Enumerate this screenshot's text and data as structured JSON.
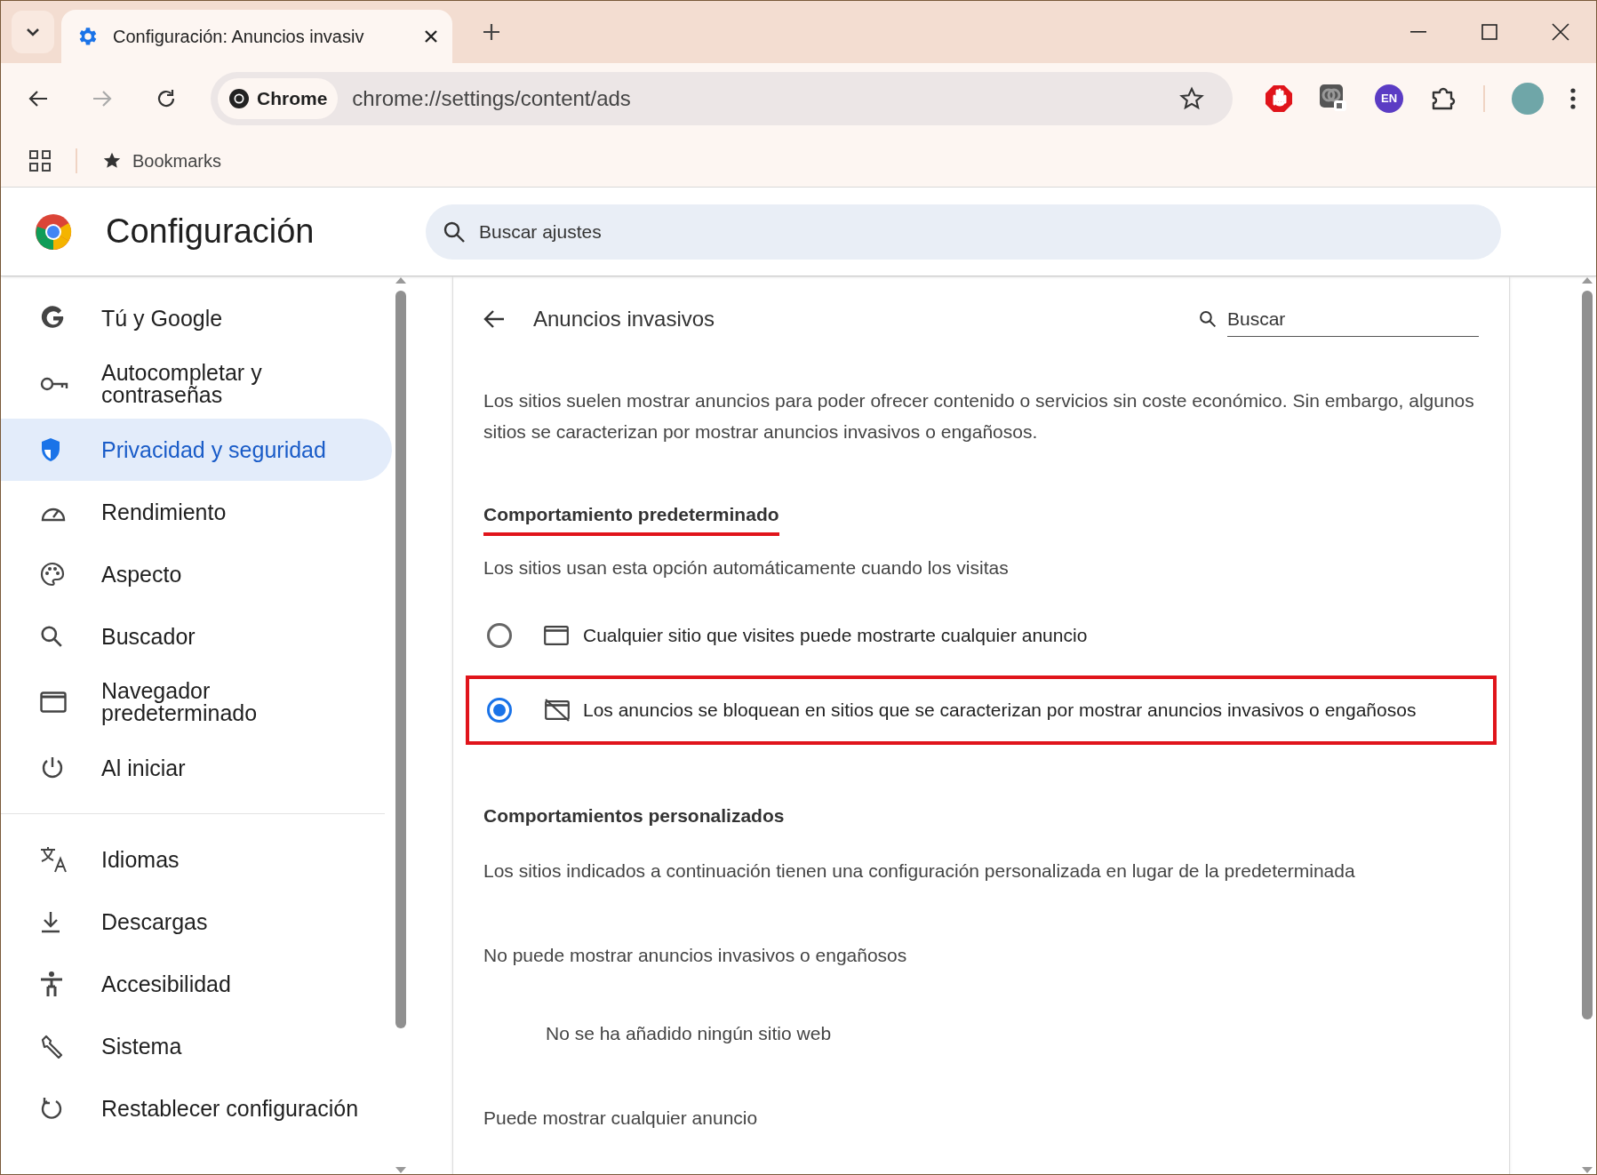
{
  "browser": {
    "tabs": [
      {
        "title": "Configuración: Anuncios invasiv",
        "selected": true
      }
    ],
    "address_bar": {
      "chip": "Chrome",
      "url": "chrome://settings/content/ads"
    },
    "extension_badge": "EN",
    "bookmarks": [
      "Bookmarks"
    ]
  },
  "settings": {
    "title": "Configuración",
    "search": {
      "placeholder": "Buscar ajustes"
    },
    "sidebar": [
      [
        {
          "label": "Tú y Google",
          "selected": false
        },
        {
          "label": "Autocompletar y contraseñas",
          "selected": false
        },
        {
          "label": "Privacidad y seguridad",
          "selected": true
        },
        {
          "label": "Rendimiento",
          "selected": false
        },
        {
          "label": "Aspecto",
          "selected": false
        },
        {
          "label": "Buscador",
          "selected": false
        },
        {
          "label": "Navegador predeterminado",
          "selected": false
        },
        {
          "label": "Al iniciar",
          "selected": false
        }
      ],
      [
        {
          "label": "Idiomas",
          "selected": false
        },
        {
          "label": "Descargas",
          "selected": false
        },
        {
          "label": "Accesibilidad",
          "selected": false
        },
        {
          "label": "Sistema",
          "selected": false
        },
        {
          "label": "Restablecer configuración",
          "selected": false
        }
      ]
    ],
    "page": {
      "title": "Anuncios invasivos",
      "search": {
        "placeholder": "Buscar"
      },
      "description": "Los sitios suelen mostrar anuncios para poder ofrecer contenido o servicios sin coste económico. Sin embargo, algunos sitios se caracterizan por mostrar anuncios invasivos o engañosos.",
      "default_behavior": {
        "heading": "Comportamiento predeterminado",
        "underlined": true,
        "hint": "Los sitios usan esta opción automáticamente cuando los visitas",
        "options": [
          {
            "label": "Cualquier sitio que visites puede mostrarte cualquier anuncio",
            "selected": false,
            "highlighted": false
          },
          {
            "label": "Los anuncios se bloquean en sitios que se caracterizan por mostrar anuncios invasivos o engañosos",
            "selected": true,
            "highlighted": true
          }
        ]
      },
      "custom_behaviors": {
        "heading": "Comportamientos personalizados",
        "hint": "Los sitios indicados a continuación tienen una configuración personalizada en lugar de la predeterminada",
        "lists": [
          {
            "heading": "No puede mostrar anuncios invasivos o engañosos",
            "empty_text": "No se ha añadido ningún sitio web"
          },
          {
            "heading": "Puede mostrar cualquier anuncio"
          }
        ]
      }
    }
  }
}
